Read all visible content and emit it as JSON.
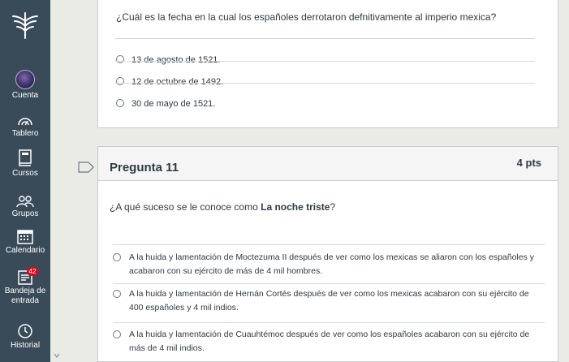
{
  "nav": {
    "logo_icon": "canvas-tree-logo-icon",
    "account_label": "Cuenta",
    "dashboard_label": "Tablero",
    "courses_label": "Cursos",
    "groups_label": "Grupos",
    "calendar_label": "Calendario",
    "inbox_label": "Bandeja de entrada",
    "inbox_badge": "42",
    "history_label": "Historial",
    "nav_color": "#394b58"
  },
  "previous_question": {
    "text": "¿Cuál es la fecha en la cual los españoles derrotaron defnitivamente al imperio mexica?",
    "answers": [
      "13 de agosto de 1521.",
      "12 de octubre de 1492.",
      "30 de mayo de 1521."
    ]
  },
  "question": {
    "title": "Pregunta 11",
    "points": "4 pts",
    "text_prefix": "¿A qué suceso se le conoce como ",
    "text_bold": "La noche triste",
    "text_suffix": "?",
    "answers": [
      "A la huida y lamentación de Moctezuma II después de ver como los mexicas se aliaron con los españoles y acabaron con su ejército de más de 4 mil hombres.",
      "A la huida y lamentación de Hernán Cortés después de ver como los mexicas acabaron con su ejército de 400 españoles y 4 mil indios.",
      "A la huida y lamentación de Cuauhtémoc después de ver como los españoles acabaron con su ejército de más de 4 mil indios."
    ]
  }
}
